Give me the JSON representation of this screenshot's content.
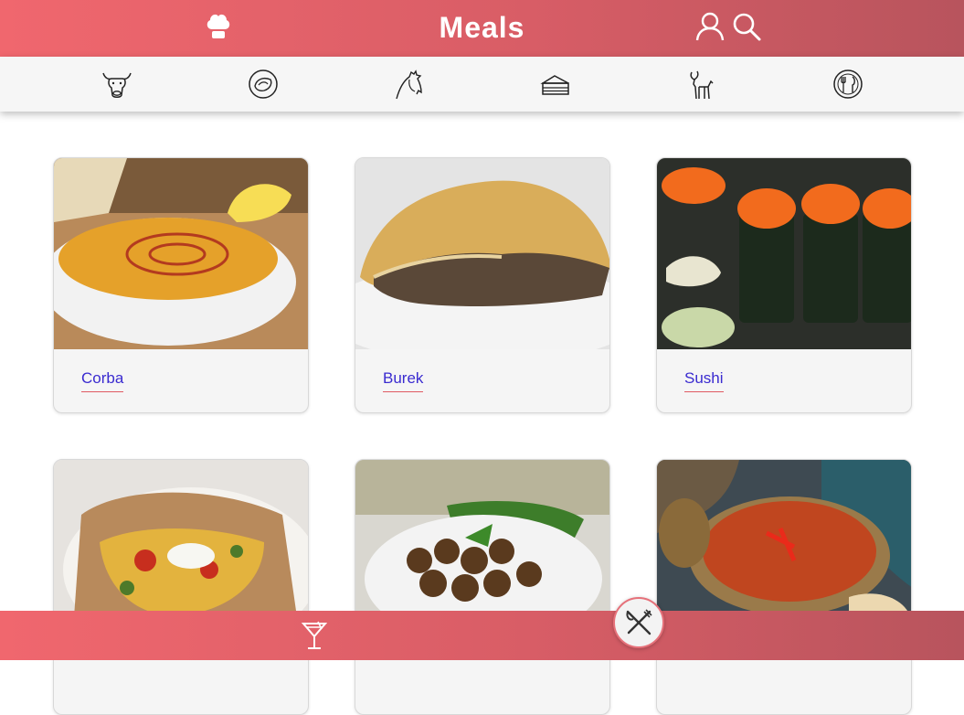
{
  "header": {
    "title": "Meals"
  },
  "categories": [
    "beef",
    "seafood",
    "chicken",
    "dessert",
    "goat",
    "miscellaneous"
  ],
  "meals": [
    {
      "name": "Corba"
    },
    {
      "name": "Burek"
    },
    {
      "name": "Sushi"
    },
    {
      "name": ""
    },
    {
      "name": ""
    },
    {
      "name": ""
    }
  ],
  "colors": {
    "accent": "#e05a62",
    "link": "#3a2bd0"
  }
}
